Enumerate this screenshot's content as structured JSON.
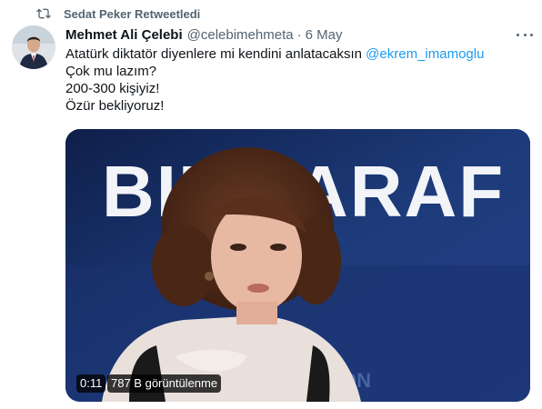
{
  "retweet": {
    "icon": "retweet-icon",
    "label": "Sedat Peker Retweetledi"
  },
  "tweet": {
    "author_name": "Mehmet Ali Çelebi",
    "handle": "@celebimehmeta",
    "separator": "·",
    "date": "6 May",
    "lines": [
      {
        "text": "Atatürk diktatör diyenlere mi kendini anlatacaksın ",
        "mention": "@ekrem_imamoglu"
      },
      {
        "text": "Çok mu lazım?"
      },
      {
        "text": "200-300 kişiyiz!"
      },
      {
        "text": "Özür bekliyoruz!"
      }
    ]
  },
  "video": {
    "on_screen_text": "BIR TARAF",
    "lower_text": "TON",
    "duration": "0:11",
    "views": "787 B görüntülenme"
  },
  "colors": {
    "link": "#1d9bf0",
    "secondary_text": "#536471",
    "primary_text": "#0f1419"
  }
}
